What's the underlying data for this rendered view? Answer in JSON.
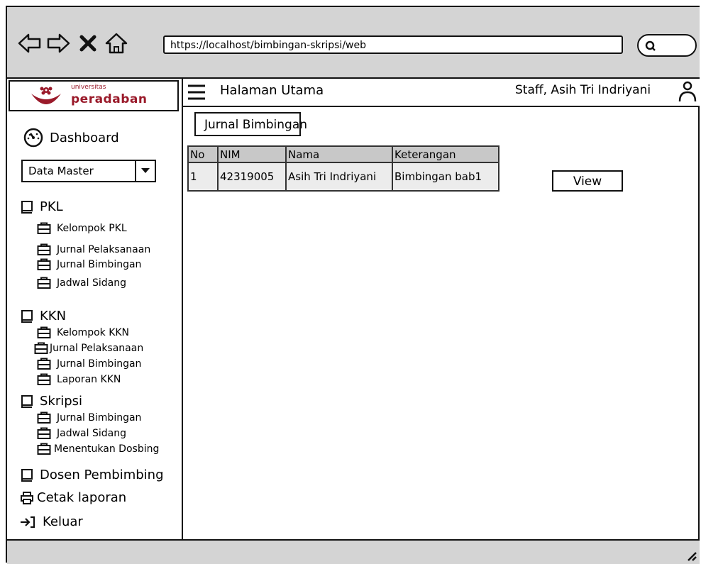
{
  "browser": {
    "url": "https://localhost/bimbingan-skripsi/web",
    "nav_icons": [
      "back-arrow-icon",
      "forward-arrow-icon",
      "close-x-icon",
      "home-icon"
    ],
    "search_icon": "search-icon"
  },
  "logo": {
    "small_text": "universitas",
    "big_text": "peradaban",
    "brand_color": "#9a1a2a"
  },
  "sidebar": {
    "dashboard_label": "Dashboard",
    "dropdown_value": "Data Master",
    "sections": [
      {
        "label": "PKL",
        "items": [
          "Kelompok PKL",
          "Jurnal Pelaksanaan",
          "Jurnal Bimbingan",
          "Jadwal Sidang"
        ]
      },
      {
        "label": "KKN",
        "items": [
          "Kelompok KKN",
          "Jurnal Pelaksanaan",
          "Jurnal Bimbingan",
          "Laporan KKN"
        ]
      },
      {
        "label": "Skripsi",
        "items": [
          "Jurnal Bimbingan",
          "Jadwal Sidang",
          "Menentukan Dosbing"
        ]
      }
    ],
    "dosen_label": "Dosen Pembimbing",
    "cetak_label": "Cetak laporan",
    "keluar_label": "Keluar"
  },
  "header": {
    "title": "Halaman Utama",
    "user": "Staff, Asih Tri Indriyani"
  },
  "main": {
    "page_title": "Jurnal Bimbingan",
    "table": {
      "headers": [
        "No",
        "NIM",
        "Nama",
        "Keterangan"
      ],
      "rows": [
        [
          "1",
          "42319005",
          "Asih Tri Indriyani",
          "Bimbingan bab1"
        ]
      ]
    },
    "view_label": "View"
  },
  "colors": {
    "chrome_gray": "#d4d4d4",
    "header_cell": "#c8c8c8",
    "row_cell": "#ececec"
  }
}
